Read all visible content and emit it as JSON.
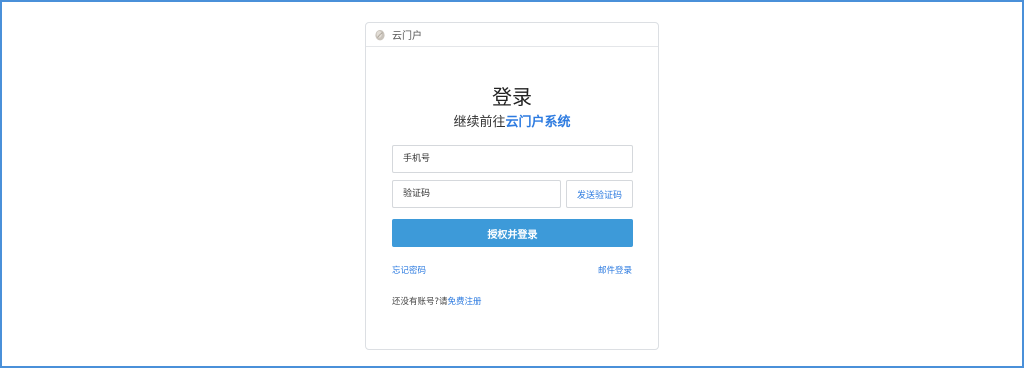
{
  "header": {
    "logo_icon": "logo-icon",
    "brand": "云门户"
  },
  "title": "登录",
  "subtitle": {
    "prefix": "继续前往",
    "accent": "云门户系统",
    "accent_color": "#2d7be0"
  },
  "form": {
    "phone_placeholder": "手机号",
    "code_placeholder": "验证码",
    "send_code_label": "发送验证码",
    "submit_label": "授权并登录",
    "submit_color": "#3d9ad9"
  },
  "links": {
    "forgot_password": "忘记密码",
    "email_login": "邮件登录",
    "register_prompt": "还没有账号?请",
    "register_link": "免费注册"
  }
}
